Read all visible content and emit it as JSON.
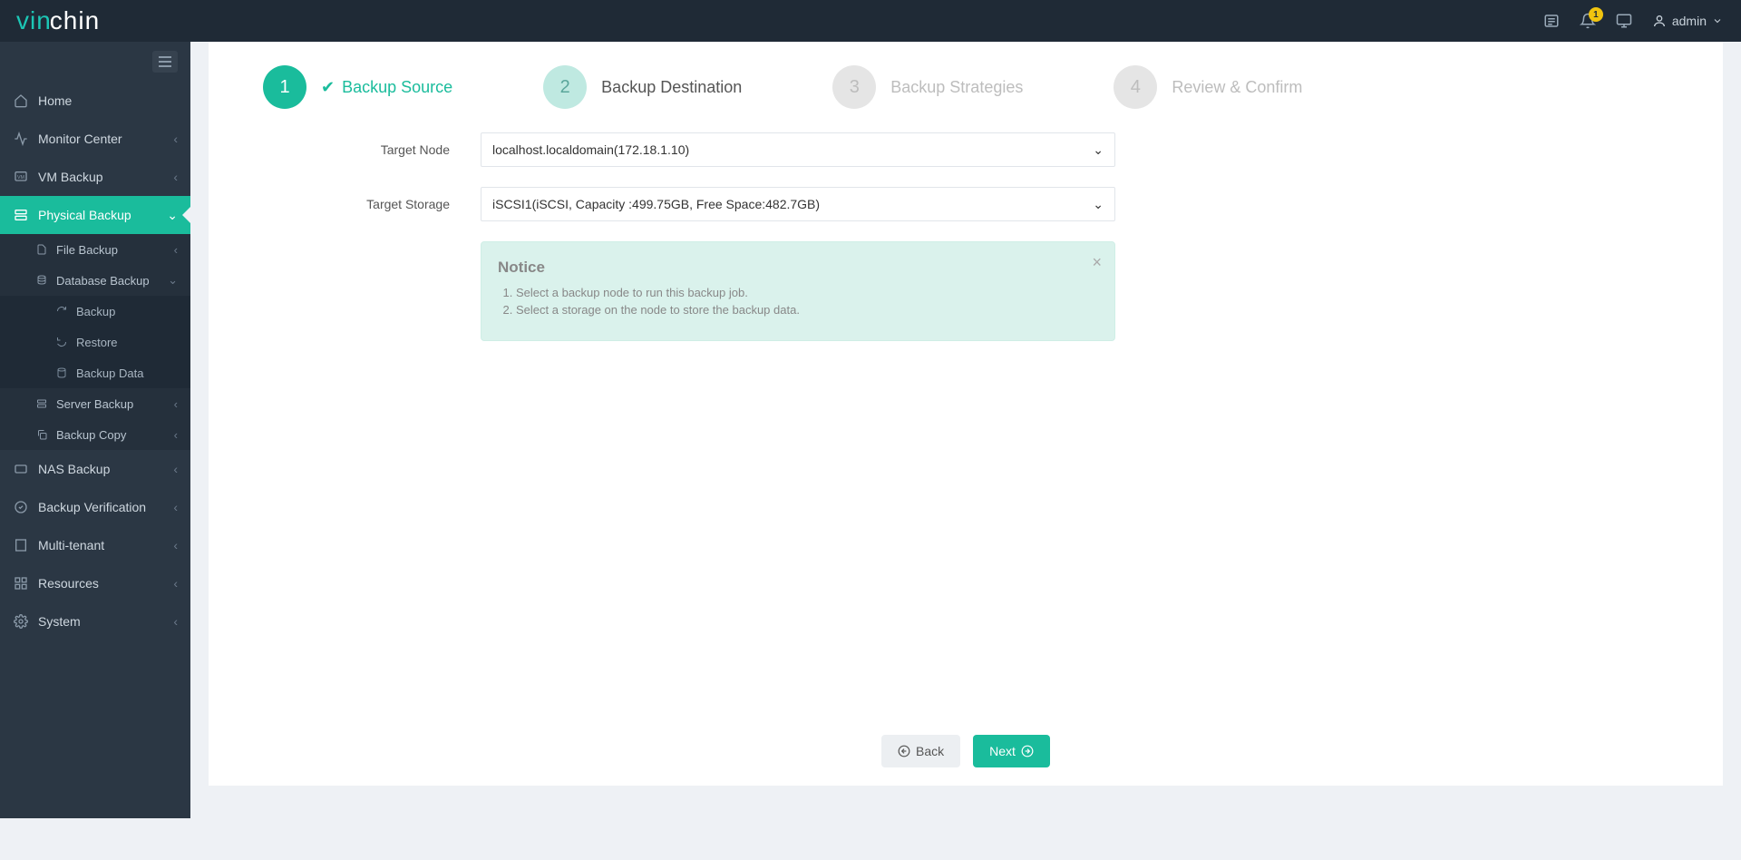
{
  "topbar": {
    "logo_part1": "vin",
    "logo_part2": "chin",
    "bell_badge": "1",
    "user_label": "admin"
  },
  "sidebar": {
    "home": "Home",
    "monitor": "Monitor Center",
    "vm_backup": "VM Backup",
    "physical_backup": "Physical Backup",
    "file_backup": "File Backup",
    "database_backup": "Database Backup",
    "db_backup": "Backup",
    "db_restore": "Restore",
    "db_backup_data": "Backup Data",
    "server_backup": "Server Backup",
    "backup_copy": "Backup Copy",
    "nas_backup": "NAS Backup",
    "backup_verification": "Backup Verification",
    "multi_tenant": "Multi-tenant",
    "resources": "Resources",
    "system": "System"
  },
  "steps": {
    "s1": {
      "num": "1",
      "label": "Backup Source"
    },
    "s2": {
      "num": "2",
      "label": "Backup Destination"
    },
    "s3": {
      "num": "3",
      "label": "Backup Strategies"
    },
    "s4": {
      "num": "4",
      "label": "Review & Confirm"
    }
  },
  "form": {
    "target_node_label": "Target Node",
    "target_node_value": "localhost.localdomain(172.18.1.10)",
    "target_storage_label": "Target Storage",
    "target_storage_value": "iSCSI1(iSCSI, Capacity :499.75GB, Free Space:482.7GB)"
  },
  "notice": {
    "title": "Notice",
    "item1": "Select a backup node to run this backup job.",
    "item2": "Select a storage on the node to store the backup data."
  },
  "buttons": {
    "back": "Back",
    "next": "Next"
  }
}
